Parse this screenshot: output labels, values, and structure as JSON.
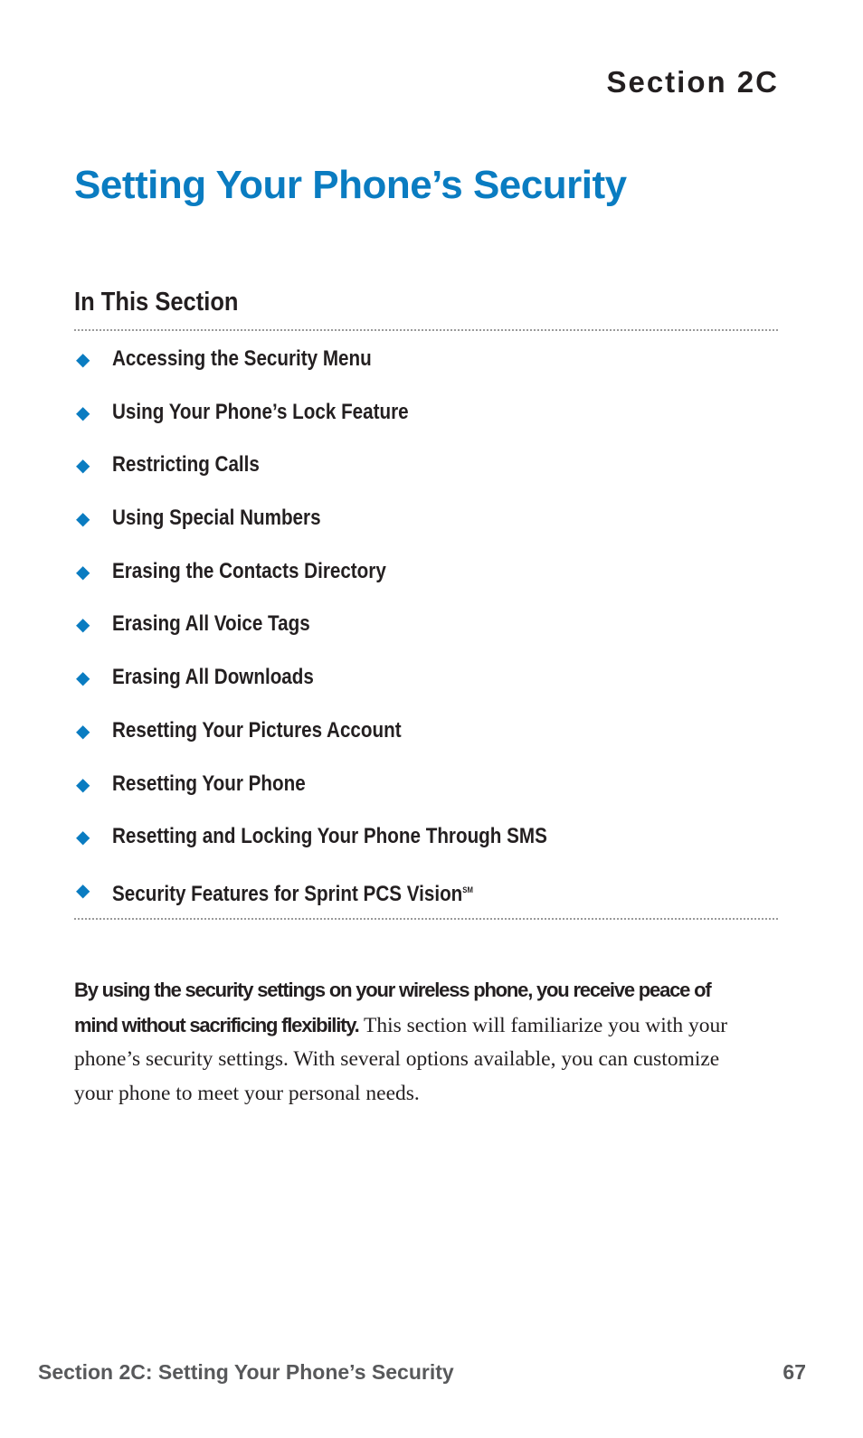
{
  "header": {
    "section_label": "Section 2C",
    "title": "Setting Your Phone’s Security"
  },
  "in_this_section": {
    "heading": "In This Section",
    "bullet_icon": "diamond-bullet",
    "items": [
      {
        "label": "Accessing the Security Menu"
      },
      {
        "label": "Using Your Phone’s Lock Feature"
      },
      {
        "label": "Restricting Calls"
      },
      {
        "label": "Using Special Numbers"
      },
      {
        "label": "Erasing the Contacts Directory"
      },
      {
        "label": "Erasing All Voice Tags"
      },
      {
        "label": "Erasing All Downloads"
      },
      {
        "label": "Resetting Your Pictures Account"
      },
      {
        "label": "Resetting Your Phone"
      },
      {
        "label": "Resetting and Locking Your Phone Through SMS"
      },
      {
        "label": "Security Features for Sprint PCS Vision",
        "superscript": "SM"
      }
    ]
  },
  "intro": {
    "lead": "By using the security settings on your wireless phone, you receive peace of mind without sacrificing flexibility.",
    "body": " This section will familiarize you with your phone’s security settings. With several options available, you can customize your phone to meet your personal needs."
  },
  "footer": {
    "title": "Section 2C: Setting Your Phone’s Security",
    "page_number": "67"
  },
  "colors": {
    "accent": "#0a7cc1",
    "text": "#231f20",
    "footer": "#58595b"
  }
}
